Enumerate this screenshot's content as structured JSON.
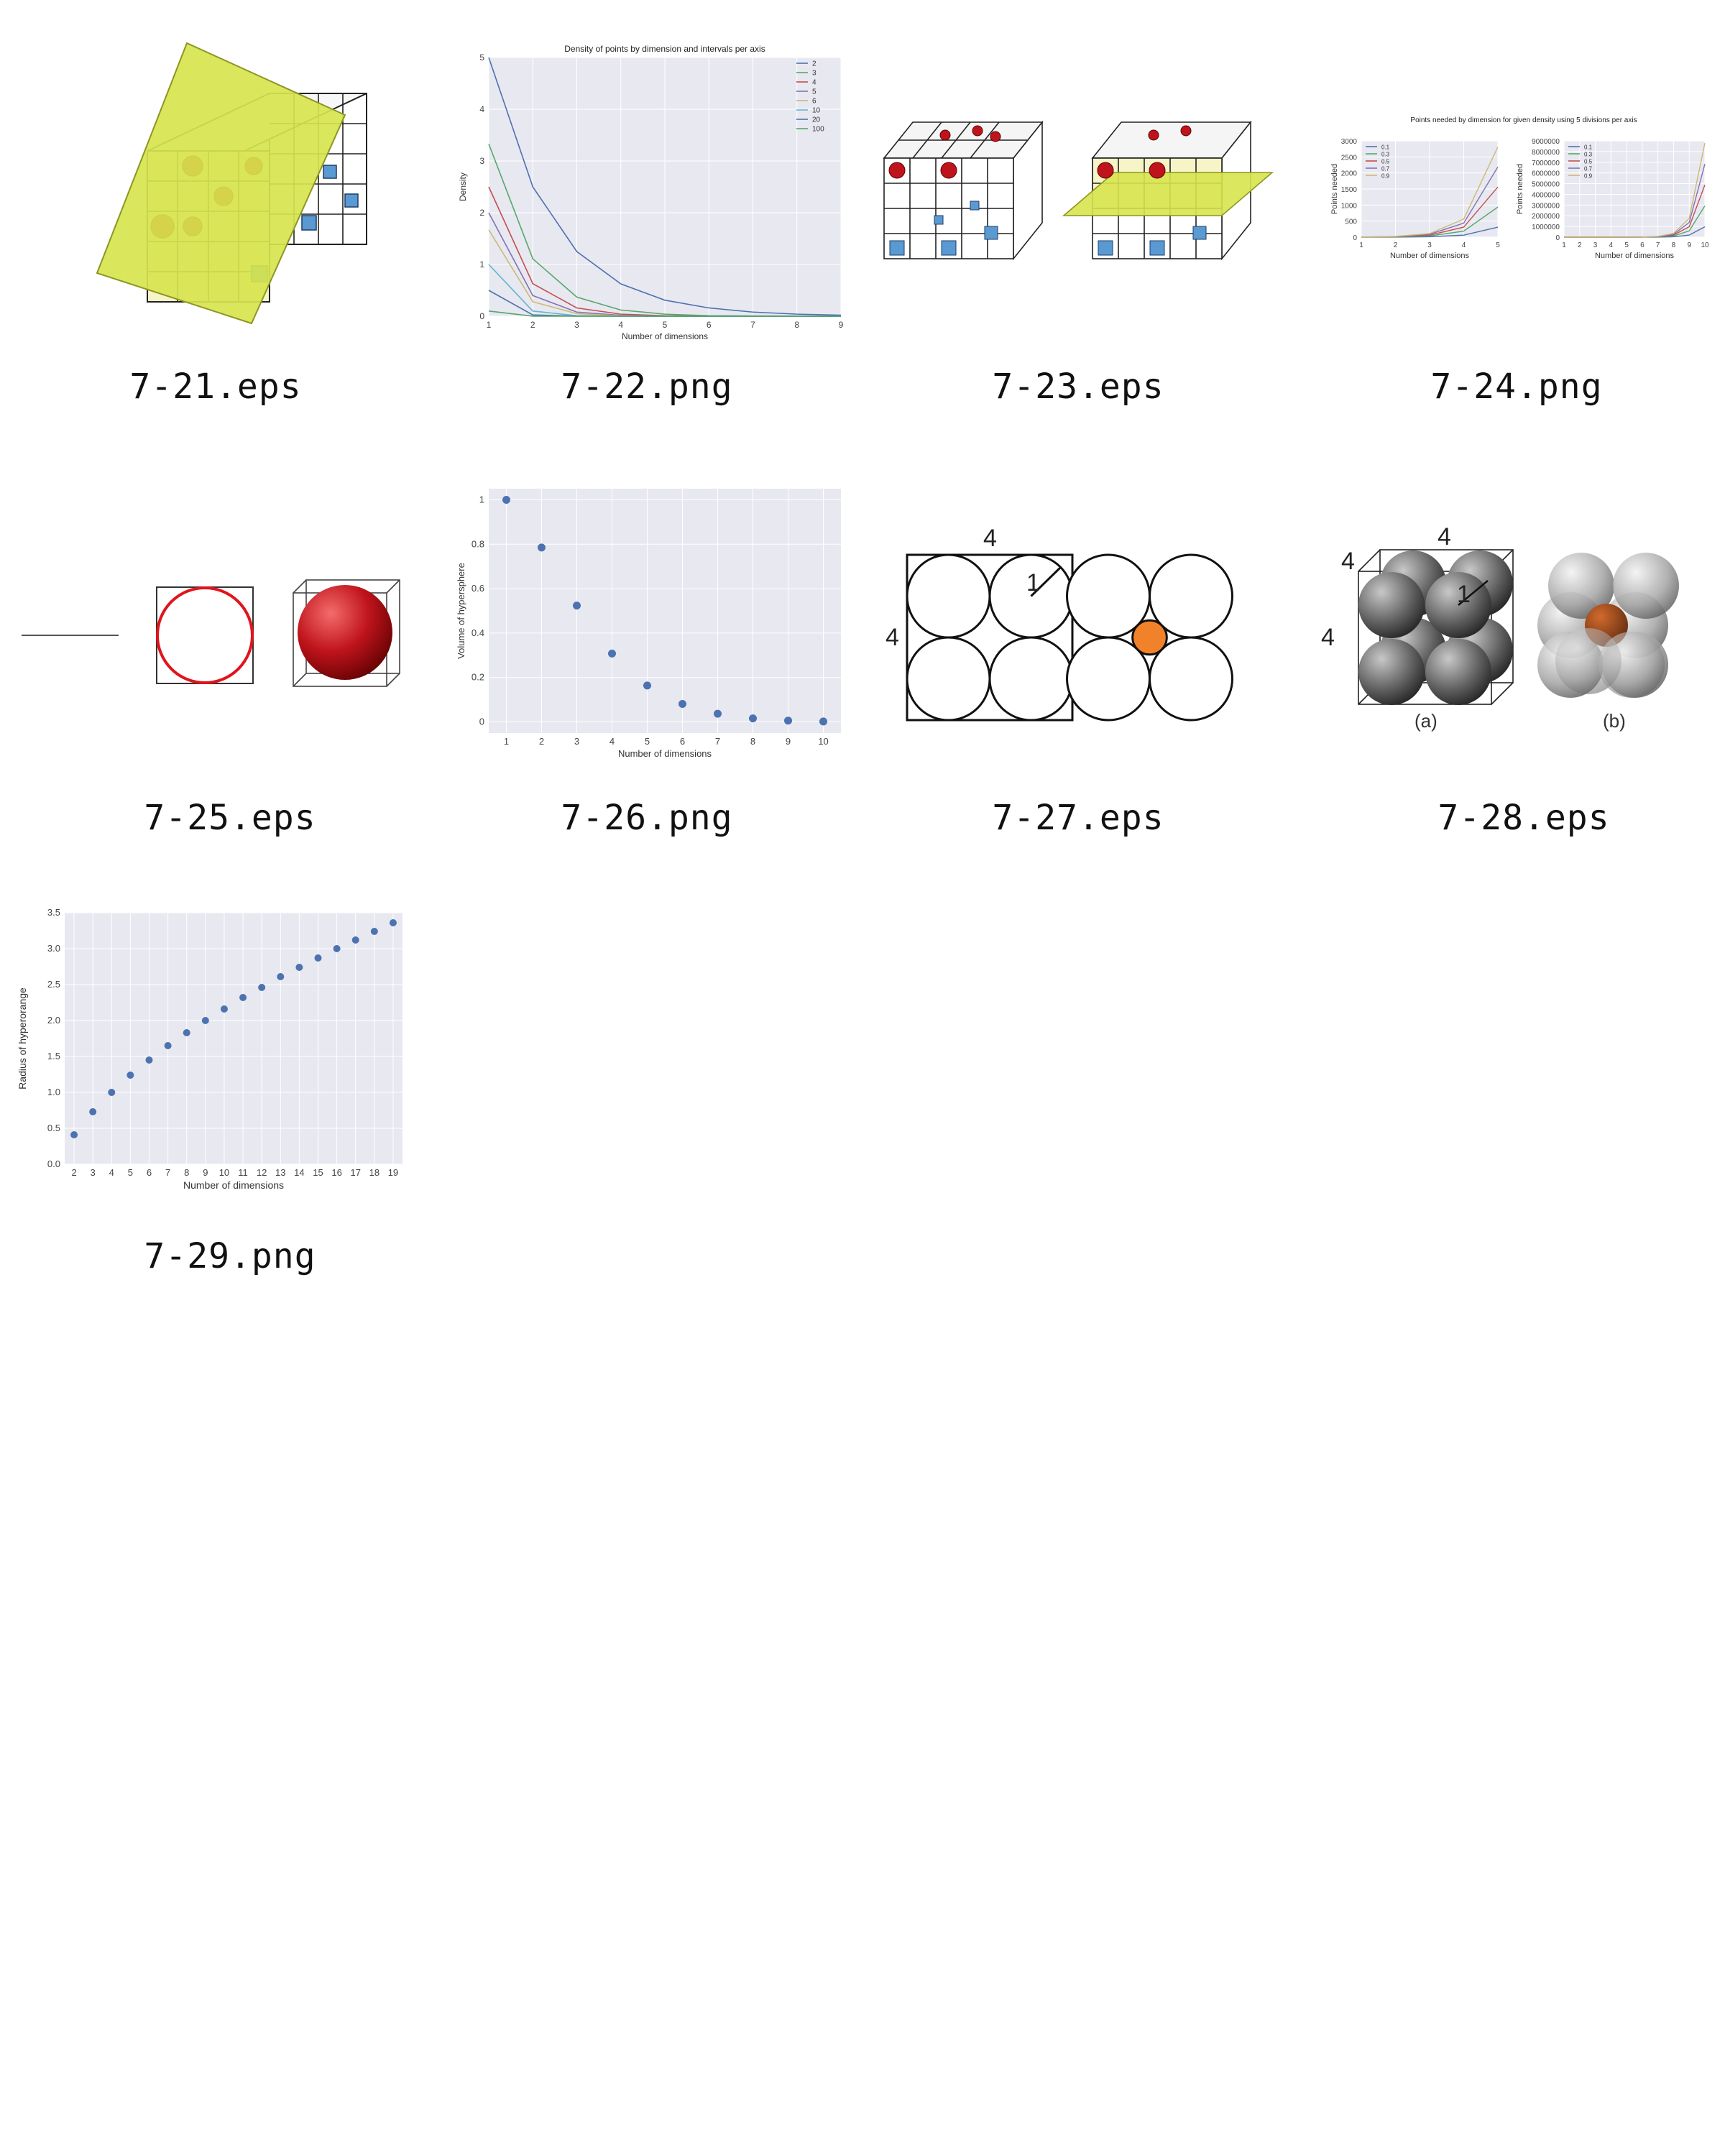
{
  "thumbnails": [
    {
      "id": "7-21",
      "caption": "7-21.eps"
    },
    {
      "id": "7-22",
      "caption": "7-22.png"
    },
    {
      "id": "7-23",
      "caption": "7-23.eps"
    },
    {
      "id": "7-24",
      "caption": "7-24.png"
    },
    {
      "id": "7-25",
      "caption": "7-25.eps"
    },
    {
      "id": "7-26",
      "caption": "7-26.png"
    },
    {
      "id": "7-27",
      "caption": "7-27.eps"
    },
    {
      "id": "7-28",
      "caption": "7-28.eps"
    },
    {
      "id": "7-29",
      "caption": "7-29.png"
    }
  ],
  "diagram_labels": {
    "d27_side": "4",
    "d27_top": "4",
    "d27_radius": "1",
    "d28_side": "4",
    "d28_top": "4",
    "d28_top_left": "4",
    "d28_radius": "1",
    "d28_a": "(a)",
    "d28_b": "(b)"
  },
  "colors": {
    "plot_bg": "#e8e8f1",
    "grid": "#ffffff",
    "point": "#4c72b0",
    "sphere_red": "#c0141c",
    "cube_blue": "#5a9ad3",
    "plane_yellow": "#d7e44e",
    "orange": "#f2822a"
  },
  "chart_data": [
    {
      "id": "7-22",
      "type": "line",
      "title": "Density of points by dimension and intervals per axis",
      "xlabel": "Number of dimensions",
      "ylabel": "Density",
      "xlim": [
        1,
        9
      ],
      "ylim": [
        0,
        5
      ],
      "xticks": [
        1,
        2,
        3,
        4,
        5,
        6,
        7,
        8,
        9
      ],
      "yticks": [
        0,
        1,
        2,
        3,
        4,
        5
      ],
      "legend_position": "top-right",
      "x": [
        1,
        2,
        3,
        4,
        5,
        6,
        7,
        8,
        9
      ],
      "series": [
        {
          "name": "2",
          "color": "#4c72b0",
          "values": [
            5,
            2.5,
            1.25,
            0.625,
            0.31,
            0.16,
            0.08,
            0.04,
            0.02
          ]
        },
        {
          "name": "3",
          "color": "#55a868",
          "values": [
            3.33,
            1.11,
            0.37,
            0.12,
            0.04,
            0.01,
            0.005,
            0.002,
            0.001
          ]
        },
        {
          "name": "4",
          "color": "#c44e52",
          "values": [
            2.5,
            0.63,
            0.16,
            0.04,
            0.01,
            0.002,
            0.001,
            0,
            0
          ]
        },
        {
          "name": "5",
          "color": "#8172b2",
          "values": [
            2.0,
            0.4,
            0.08,
            0.016,
            0.003,
            0.001,
            0,
            0,
            0
          ]
        },
        {
          "name": "6",
          "color": "#ccb974",
          "values": [
            1.67,
            0.28,
            0.05,
            0.008,
            0.001,
            0,
            0,
            0,
            0
          ]
        },
        {
          "name": "10",
          "color": "#64b5cd",
          "values": [
            1.0,
            0.1,
            0.01,
            0.001,
            0,
            0,
            0,
            0,
            0
          ]
        },
        {
          "name": "20",
          "color": "#4c72b0",
          "values": [
            0.5,
            0.025,
            0.001,
            0,
            0,
            0,
            0,
            0,
            0
          ]
        },
        {
          "name": "100",
          "color": "#55a868",
          "values": [
            0.1,
            0.001,
            0,
            0,
            0,
            0,
            0,
            0,
            0
          ]
        }
      ]
    },
    {
      "id": "7-24a",
      "type": "line",
      "title": "Points needed by dimension for given density using 5 divisions per axis",
      "xlabel": "Number of dimensions",
      "ylabel": "Points needed",
      "xlim": [
        1,
        5
      ],
      "ylim": [
        0,
        3000
      ],
      "xticks": [
        1,
        2,
        3,
        4,
        5
      ],
      "yticks": [
        0,
        500,
        1000,
        1500,
        2000,
        2500,
        3000
      ],
      "legend_position": "top-left",
      "x": [
        1,
        2,
        3,
        4,
        5
      ],
      "series": [
        {
          "name": "0.1",
          "color": "#4c72b0",
          "values": [
            0.5,
            2.5,
            12.5,
            62.5,
            312.5
          ]
        },
        {
          "name": "0.3",
          "color": "#55a868",
          "values": [
            1.5,
            7.5,
            37.5,
            187.5,
            937.5
          ]
        },
        {
          "name": "0.5",
          "color": "#c44e52",
          "values": [
            2.5,
            12.5,
            62.5,
            312.5,
            1562.5
          ]
        },
        {
          "name": "0.7",
          "color": "#8172b2",
          "values": [
            3.5,
            17.5,
            87.5,
            437.5,
            2187.5
          ]
        },
        {
          "name": "0.9",
          "color": "#ccb974",
          "values": [
            4.5,
            22.5,
            112.5,
            562.5,
            2812.5
          ]
        }
      ]
    },
    {
      "id": "7-24b",
      "type": "line",
      "xlabel": "Number of dimensions",
      "ylabel": "Points needed",
      "xlim": [
        1,
        10
      ],
      "ylim": [
        0,
        9000000
      ],
      "xticks": [
        1,
        2,
        3,
        4,
        5,
        6,
        7,
        8,
        9,
        10
      ],
      "yticks": [
        0,
        1000000,
        2000000,
        3000000,
        4000000,
        5000000,
        6000000,
        7000000,
        8000000,
        9000000
      ],
      "legend_position": "top-left",
      "x": [
        1,
        2,
        3,
        4,
        5,
        6,
        7,
        8,
        9,
        10
      ],
      "series": [
        {
          "name": "0.1",
          "color": "#4c72b0",
          "values": [
            0.5,
            2.5,
            12.5,
            62.5,
            312.5,
            1562.5,
            7812.5,
            39062.5,
            195312.5,
            976562.5
          ]
        },
        {
          "name": "0.3",
          "color": "#55a868",
          "values": [
            1.5,
            7.5,
            37.5,
            187.5,
            937.5,
            4687.5,
            23437.5,
            117187.5,
            585937.5,
            2929687.5
          ]
        },
        {
          "name": "0.5",
          "color": "#c44e52",
          "values": [
            2.5,
            12.5,
            62.5,
            312.5,
            1562.5,
            7812.5,
            39062.5,
            195312.5,
            976562.5,
            4882812.5
          ]
        },
        {
          "name": "0.7",
          "color": "#8172b2",
          "values": [
            3.5,
            17.5,
            87.5,
            437.5,
            2187.5,
            10937.5,
            54687.5,
            273437.5,
            1367187.5,
            6835937.5
          ]
        },
        {
          "name": "0.9",
          "color": "#ccb974",
          "values": [
            4.5,
            22.5,
            112.5,
            562.5,
            2812.5,
            14062.5,
            70312.5,
            351562.5,
            1757812.5,
            8789062.5
          ]
        }
      ]
    },
    {
      "id": "7-26",
      "type": "scatter",
      "xlabel": "Number of dimensions",
      "ylabel": "Volume of hypersphere",
      "xlim": [
        0.5,
        10.5
      ],
      "ylim": [
        -0.05,
        1.05
      ],
      "xticks": [
        1,
        2,
        3,
        4,
        5,
        6,
        7,
        8,
        9,
        10
      ],
      "yticks": [
        0,
        0.2,
        0.4,
        0.6,
        0.8,
        1
      ],
      "x": [
        1,
        2,
        3,
        4,
        5,
        6,
        7,
        8,
        9,
        10
      ],
      "series": [
        {
          "values": [
            1,
            0.785,
            0.524,
            0.308,
            0.164,
            0.081,
            0.037,
            0.016,
            0.006,
            0.002
          ]
        }
      ]
    },
    {
      "id": "7-29",
      "type": "scatter",
      "xlabel": "Number of dimensions",
      "ylabel": "Radius of hyperorange",
      "xlim": [
        1.5,
        19.5
      ],
      "ylim": [
        0,
        3.5
      ],
      "xticks": [
        2,
        3,
        4,
        5,
        6,
        7,
        8,
        9,
        10,
        11,
        12,
        13,
        14,
        15,
        16,
        17,
        18,
        19
      ],
      "yticks": [
        0.0,
        0.5,
        1.0,
        1.5,
        2.0,
        2.5,
        3.0,
        3.5
      ],
      "x": [
        2,
        3,
        4,
        5,
        6,
        7,
        8,
        9,
        10,
        11,
        12,
        13,
        14,
        15,
        16,
        17,
        18,
        19
      ],
      "series": [
        {
          "values": [
            0.41,
            0.73,
            1.0,
            1.24,
            1.45,
            1.65,
            1.83,
            2.0,
            2.16,
            2.32,
            2.46,
            2.61,
            2.74,
            2.87,
            3.0,
            3.12,
            3.24,
            3.36
          ]
        }
      ]
    }
  ]
}
